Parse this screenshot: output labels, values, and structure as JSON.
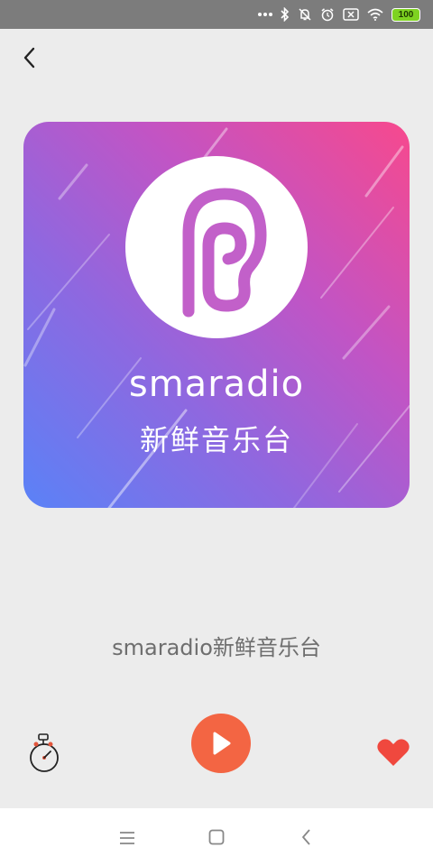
{
  "status_bar": {
    "battery_level": "100",
    "icons": [
      "more-dots-icon",
      "bluetooth-icon",
      "mute-icon",
      "alarm-icon",
      "sim-off-icon",
      "wifi-icon",
      "battery-icon"
    ]
  },
  "header": {
    "back_icon": "chevron-left-icon"
  },
  "cover": {
    "brand": "smaradio",
    "subtitle": "新鲜音乐台",
    "logo_icon": "ear-p-logo-icon",
    "colors": {
      "gradient_start": "#5a82f7",
      "gradient_end": "#f7498d"
    }
  },
  "station": {
    "title": "smaradio新鲜音乐台"
  },
  "controls": {
    "timer_icon": "sleep-timer-icon",
    "play_icon": "play-icon",
    "favorite_icon": "heart-icon",
    "play_color": "#f36543",
    "favorite_color": "#f0483e"
  },
  "nav_bar": {
    "icons": [
      "menu-icon",
      "home-icon",
      "back-icon"
    ]
  }
}
